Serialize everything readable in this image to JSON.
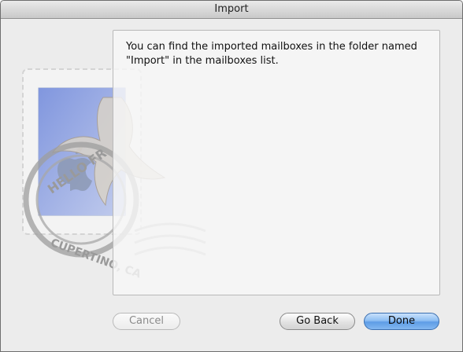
{
  "window": {
    "title": "Import"
  },
  "message": {
    "line1": "You can find the imported mailboxes in the folder named",
    "line2": "\"Import\" in the mailboxes list."
  },
  "stamp": {
    "postmark_text": "HELLO FR",
    "postmark_city": "CUPERTINO, CA"
  },
  "buttons": {
    "cancel": "Cancel",
    "go_back": "Go Back",
    "done": "Done"
  }
}
